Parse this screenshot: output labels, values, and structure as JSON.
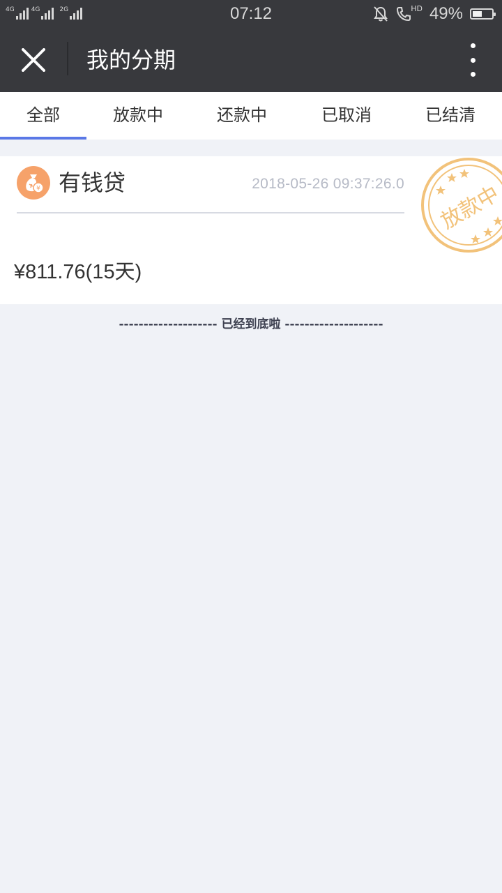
{
  "status_bar": {
    "networks": [
      {
        "label": "4G",
        "icon": "signal-bars-icon"
      },
      {
        "label": "4G",
        "icon": "signal-bars-icon"
      },
      {
        "label": "2G",
        "icon": "signal-bars-icon"
      }
    ],
    "time": "07:12",
    "battery_percent": "49%",
    "battery_level": 0.49,
    "hd_label": "HD",
    "icons": [
      "mute-bell-icon",
      "hd-call-icon",
      "battery-icon"
    ]
  },
  "header": {
    "title": "我的分期",
    "left_icon": "close-icon",
    "right_icon": "more-vertical-icon"
  },
  "tabs": [
    {
      "label": "全部",
      "active": true
    },
    {
      "label": "放款中",
      "active": false
    },
    {
      "label": "还款中",
      "active": false
    },
    {
      "label": "已取消",
      "active": false
    },
    {
      "label": "已结清",
      "active": false
    }
  ],
  "orders": [
    {
      "lender": "有钱贷",
      "lender_icon": "money-bag-icon",
      "time": "2018-05-26 09:37:26.0",
      "amount": "¥811.76(15天)",
      "stamp": "放款中"
    }
  ],
  "footer": {
    "end_text": "-------------------- 已经到底啦 --------------------"
  },
  "colors": {
    "dark_bar": "#38393d",
    "tab_indicator": "#5a78e6",
    "stamp": "#f2c27a",
    "lender_icon_bg": "#f6a26a",
    "background": "#f0f2f7"
  }
}
